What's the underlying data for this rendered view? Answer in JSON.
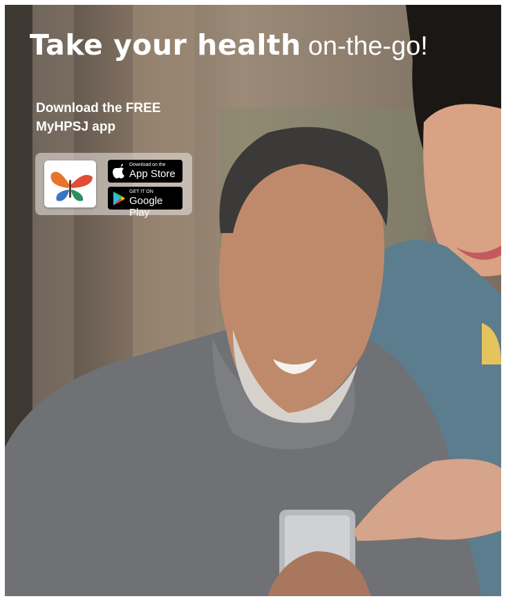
{
  "promo": {
    "headline_script": "Take your health",
    "headline_plain": "on-the-go!",
    "sub_line1": "Download the FREE",
    "sub_line2": "MyHPSJ app"
  },
  "badges": {
    "apple_small": "Download on the",
    "apple_big": "App Store",
    "google_small": "GET IT ON",
    "google_big": "Google Play"
  },
  "icons": {
    "app_logo": "butterfly-icon",
    "apple": "apple-icon",
    "google": "google-play-icon"
  },
  "colors": {
    "headline": "#ffffff",
    "badge_bg": "#000000"
  }
}
